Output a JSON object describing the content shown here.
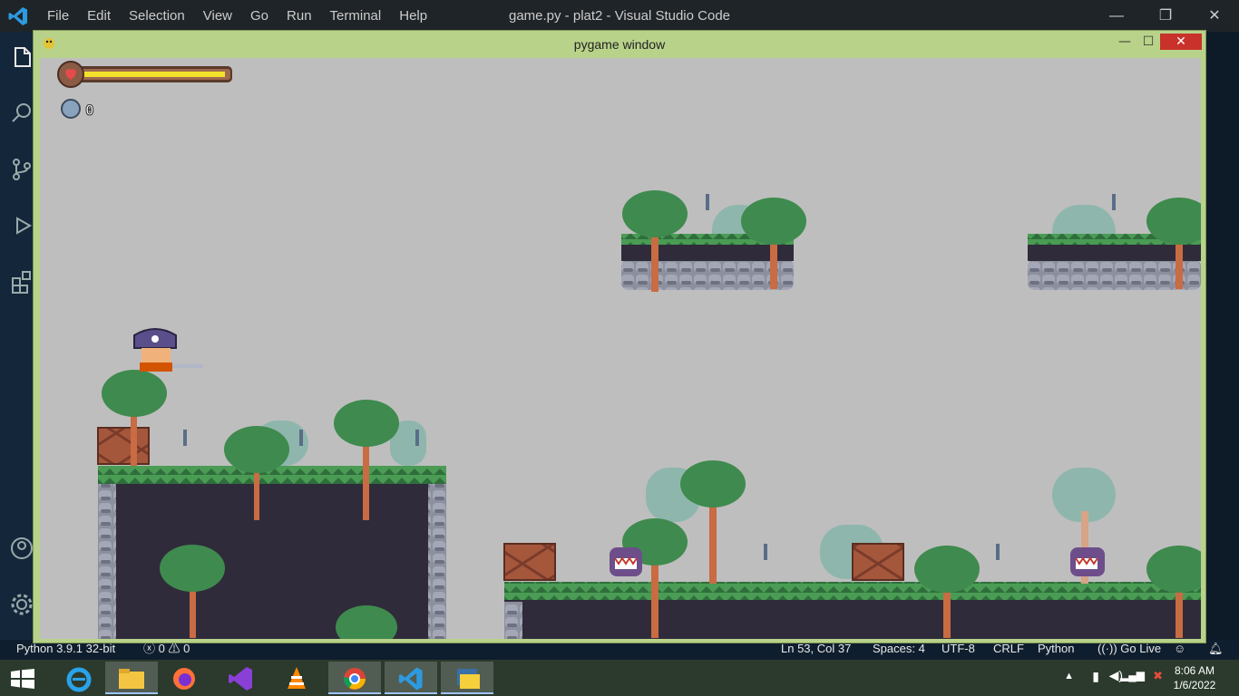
{
  "vscode": {
    "menu": [
      "File",
      "Edit",
      "Selection",
      "View",
      "Go",
      "Run",
      "Terminal",
      "Help"
    ],
    "title": "game.py - plat2 - Visual Studio Code",
    "window_controls": {
      "minimize": "—",
      "restore": "❐",
      "close": "✕"
    }
  },
  "status_bar": {
    "interpreter": "Python 3.9.1 32-bit",
    "errors": "0",
    "warnings": "0",
    "cursor": "Ln 53, Col 37",
    "spaces": "Spaces: 4",
    "encoding": "UTF-8",
    "eol": "CRLF",
    "language": "Python",
    "live": "Go Live"
  },
  "pygame": {
    "title": "pygame window",
    "controls": {
      "minimize": "—",
      "maximize": "☐",
      "close": "✕"
    },
    "hud": {
      "health_fraction": 1.0,
      "coins": "0"
    }
  },
  "taskbar": {
    "apps": [
      "start-button",
      "internet-explorer",
      "file-explorer",
      "firefox",
      "visual-studio",
      "vlc",
      "chrome",
      "vscode",
      "python"
    ],
    "time": "8:06 AM",
    "date": "1/6/2022"
  },
  "colors": {
    "pygame_frame": "#b8d28a",
    "game_bg": "#bebebe",
    "grass": "#3d7a45",
    "dirt": "#2f2b3a",
    "stone": "#76788a",
    "palm": "#3f8a4e",
    "trunk": "#c96b43"
  }
}
